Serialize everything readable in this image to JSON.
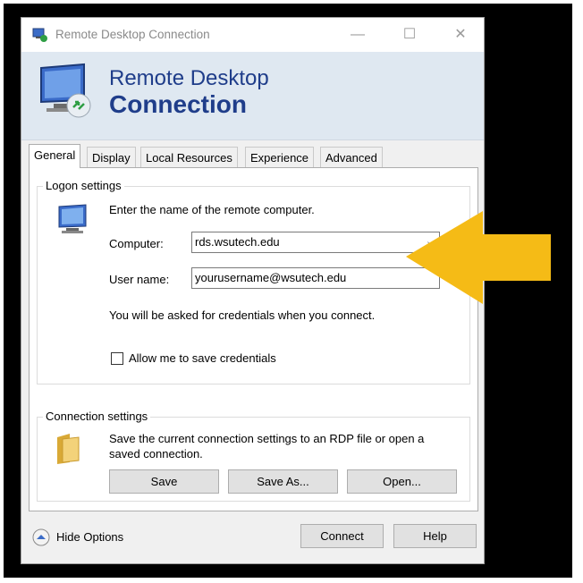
{
  "window": {
    "title": "Remote Desktop Connection",
    "controls": {
      "minimize": "—",
      "maximize": "☐",
      "close": "✕"
    }
  },
  "banner": {
    "line1": "Remote Desktop",
    "line2": "Connection"
  },
  "tabs": [
    "General",
    "Display",
    "Local Resources",
    "Experience",
    "Advanced"
  ],
  "logon": {
    "legend": "Logon settings",
    "instruction": "Enter the name of the remote computer.",
    "computer_label": "Computer:",
    "computer_value": "rds.wsutech.edu",
    "username_label": "User name:",
    "username_value": "yourusername@wsutech.edu",
    "credentials_note": "You will be asked for credentials when you connect.",
    "save_credentials_label": "Allow me to save credentials"
  },
  "connection": {
    "legend": "Connection settings",
    "description_line1": "Save the current connection settings to an RDP file or open a",
    "description_line2": "saved connection.",
    "buttons": {
      "save": "Save",
      "save_as": "Save As...",
      "open": "Open..."
    }
  },
  "footer": {
    "hide_options": "Hide Options",
    "connect": "Connect",
    "help": "Help"
  },
  "colors": {
    "banner_text": "#1f3d8a",
    "banner_bg": "#dfe8f1",
    "arrow": "#f5bb16"
  }
}
